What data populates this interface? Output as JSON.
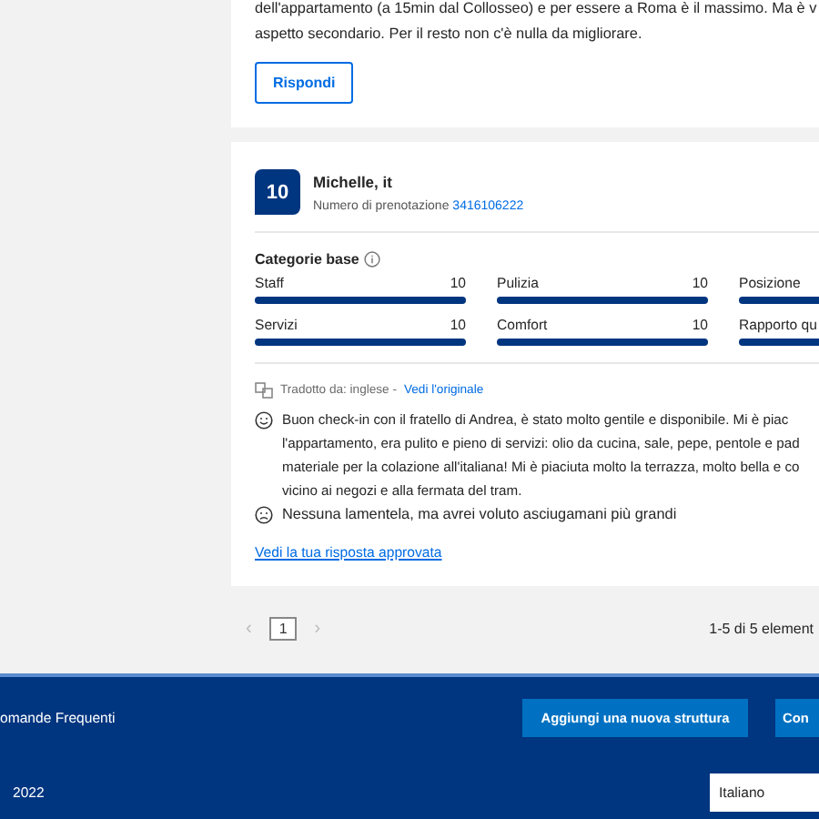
{
  "previous_review": {
    "text_lines": [
      "dell'appartamento (a 15min dal Collosseo) e per essere a Roma è il massimo. Ma è v",
      "aspetto secondario. Per il resto non c'è nulla da migliorare."
    ],
    "reply_button": "Rispondi"
  },
  "review": {
    "score": "10",
    "guest": "Michelle, it",
    "booking_label": "Numero di prenotazione",
    "booking_number": "3416106222",
    "categories_title": "Categorie base",
    "categories": [
      {
        "label": "Staff",
        "value": "10",
        "level": 1
      },
      {
        "label": "Pulizia",
        "value": "10",
        "level": 1
      },
      {
        "label": "Posizione",
        "level": 1
      },
      {
        "label": "Servizi",
        "value": "10",
        "level": 1
      },
      {
        "label": "Comfort",
        "value": "10",
        "level": 1
      },
      {
        "label": "Rapporto qu",
        "level": 1
      }
    ],
    "translation_label": "Tradotto da: inglese -",
    "translation_link": "Vedi l'originale",
    "positive_lines": [
      "Buon check-in con il fratello di Andrea, è stato molto gentile e disponibile. Mi è piac",
      "l'appartamento, era pulito e pieno di servizi: olio da cucina, sale, pepe, pentole e pad",
      "materiale per la colazione all'italiana! Mi è piaciuta molto la terrazza, molto bella e co",
      "vicino ai negozi e alla fermata del tram."
    ],
    "negative_lines": [
      "Nessuna lamentela, ma avrei voluto asciugamani più grandi"
    ],
    "reply_link": "Vedi la tua risposta approvata"
  },
  "pagination": {
    "prev": "‹",
    "pages": [
      {
        "label": "1",
        "selected": true
      }
    ],
    "next": "›",
    "summary": "1-5 di 5 element"
  },
  "footer": {
    "link": "omande Frequenti",
    "buttons": [
      "Aggiungi una nuova struttura",
      "Con"
    ],
    "year": "2022",
    "language": "Italiano"
  }
}
